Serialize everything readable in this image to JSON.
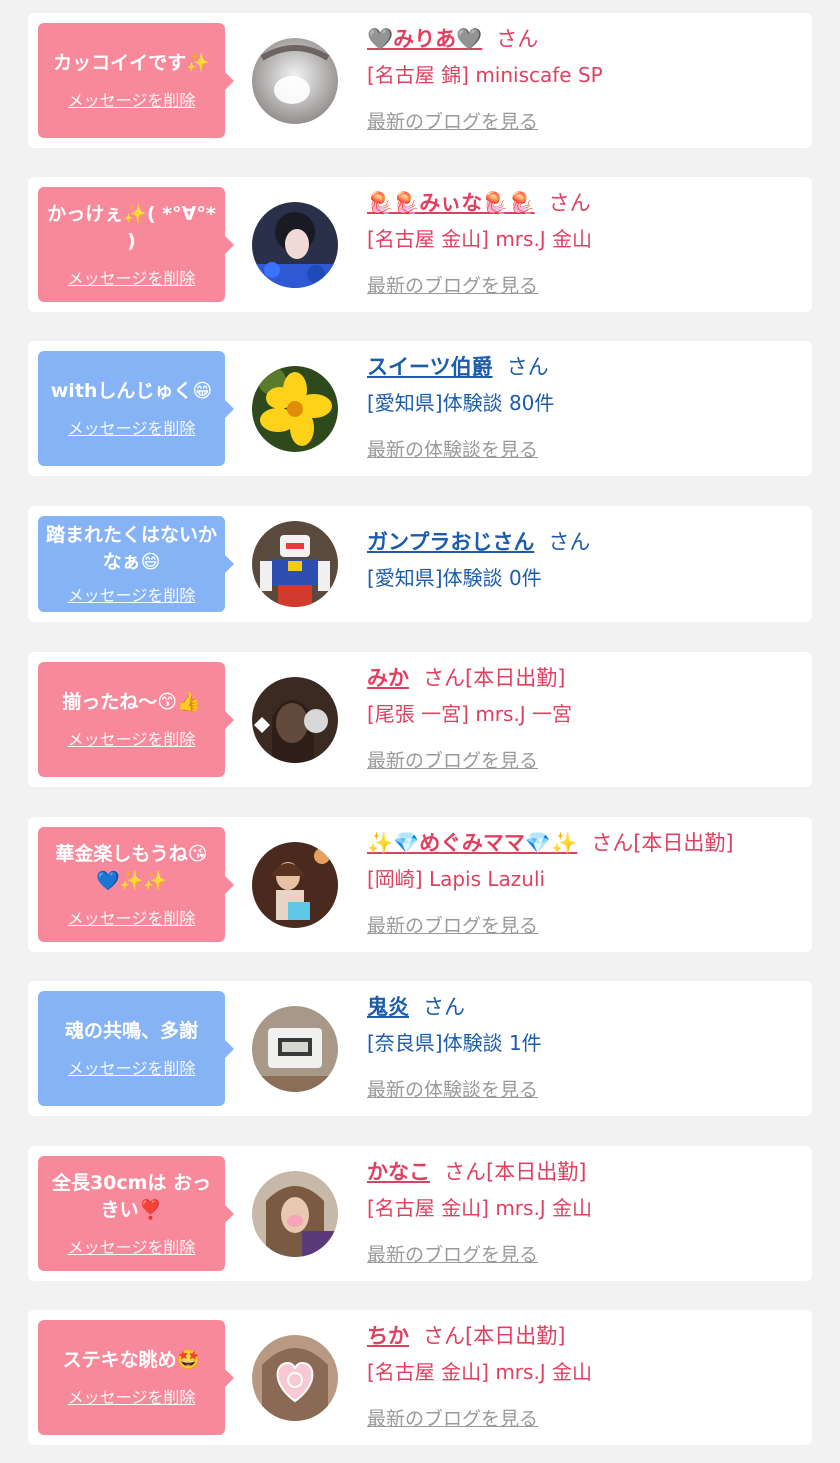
{
  "delete_label": "メッセージを削除",
  "colors": {
    "pink": "#f7899b",
    "blue": "#86b3f5",
    "pink_text": "#e0405f",
    "blue_text": "#1d5cab",
    "link": "#9a9a9a"
  },
  "items": [
    {
      "theme": "pink",
      "message": "カッコイイです✨",
      "name": "🩶みりあ🩶",
      "suffix": "さん",
      "sub": "[名古屋 錦] miniscafe SP",
      "link": "最新のブログを見る",
      "avatar_icon": "avatar-photo"
    },
    {
      "theme": "pink",
      "message": "かっけぇ✨( *°∀°* )",
      "name": "🪼🪼みぃな🪼🪼",
      "suffix": "さん",
      "sub": "[名古屋 金山] mrs.J 金山",
      "link": "最新のブログを見る",
      "avatar_icon": "avatar-photo"
    },
    {
      "theme": "blue",
      "message": "withしんじゅく😁",
      "name": "スイーツ伯爵",
      "suffix": "さん",
      "sub": "[愛知県]体験談 80件",
      "link": "最新の体験談を見る",
      "avatar_icon": "flower-photo"
    },
    {
      "theme": "blue",
      "message": "踏まれたくはないかなぁ😄",
      "name": "ガンプラおじさん",
      "suffix": "さん",
      "sub": "[愛知県]体験談 0件",
      "link": "",
      "avatar_icon": "robot-photo"
    },
    {
      "theme": "pink",
      "message": "揃ったね〜😙👍",
      "name": "みか",
      "suffix": "さん[本日出勤]",
      "sub": "[尾張 一宮] mrs.J 一宮",
      "link": "最新のブログを見る",
      "avatar_icon": "avatar-photo"
    },
    {
      "theme": "pink",
      "message": "華金楽しもうね😘💙✨✨",
      "name": "✨💎めぐみママ💎✨",
      "suffix": "さん[本日出勤]",
      "sub": "[岡崎] Lapis Lazuli",
      "link": "最新のブログを見る",
      "avatar_icon": "avatar-photo"
    },
    {
      "theme": "blue",
      "message": "魂の共鳴、多謝",
      "name": "鬼炎",
      "suffix": "さん",
      "sub": "[奈良県]体験談 1件",
      "link": "最新の体験談を見る",
      "avatar_icon": "clock-photo"
    },
    {
      "theme": "pink",
      "message": "全長30cmは おっきい❣️",
      "name": "かなこ",
      "suffix": "さん[本日出勤]",
      "sub": "[名古屋 金山] mrs.J 金山",
      "link": "最新のブログを見る",
      "avatar_icon": "avatar-photo"
    },
    {
      "theme": "pink",
      "message": "ステキな眺め🤩",
      "name": "ちか",
      "suffix": "さん[本日出勤]",
      "sub": "[名古屋 金山] mrs.J 金山",
      "link": "最新のブログを見る",
      "avatar_icon": "heart-photo"
    }
  ]
}
